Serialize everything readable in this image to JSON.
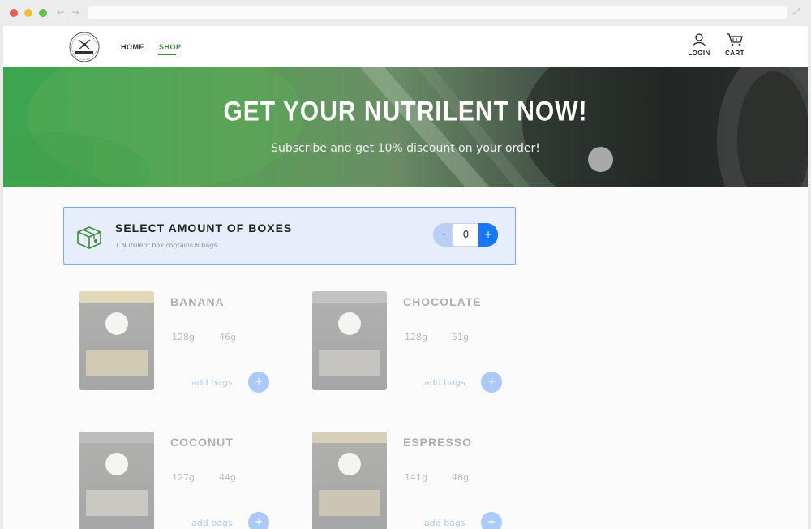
{
  "colors": {
    "brand_green": "#3f8a3a",
    "accent_blue": "#1877f2",
    "selector_bg": "#e5eefa"
  },
  "header": {
    "nav": [
      {
        "label": "HOME"
      },
      {
        "label": "SHOP"
      }
    ],
    "login_label": "LOGIN",
    "cart_label": "CART"
  },
  "hero": {
    "title": "GET YOUR NUTRILENT NOW!",
    "subtitle": "Subscribe and get 10% discount on your order!"
  },
  "selector": {
    "title": "SELECT AMOUNT OF BOXES",
    "description": "1 Nutrilent box contains 6 bags.",
    "quantity": "0",
    "minus_label": "-",
    "plus_label": "+"
  },
  "products": [
    {
      "name": "BANANA",
      "stat_a": "128g",
      "stat_b": "46g",
      "add_label": "add bags",
      "add_icon": "+"
    },
    {
      "name": "CHOCOLATE",
      "stat_a": "128g",
      "stat_b": "51g",
      "add_label": "add bags",
      "add_icon": "+"
    },
    {
      "name": "COCONUT",
      "stat_a": "127g",
      "stat_b": "44g",
      "add_label": "add bags",
      "add_icon": "+"
    },
    {
      "name": "ESPRESSO",
      "stat_a": "141g",
      "stat_b": "48g",
      "add_label": "add bags",
      "add_icon": "+"
    }
  ]
}
